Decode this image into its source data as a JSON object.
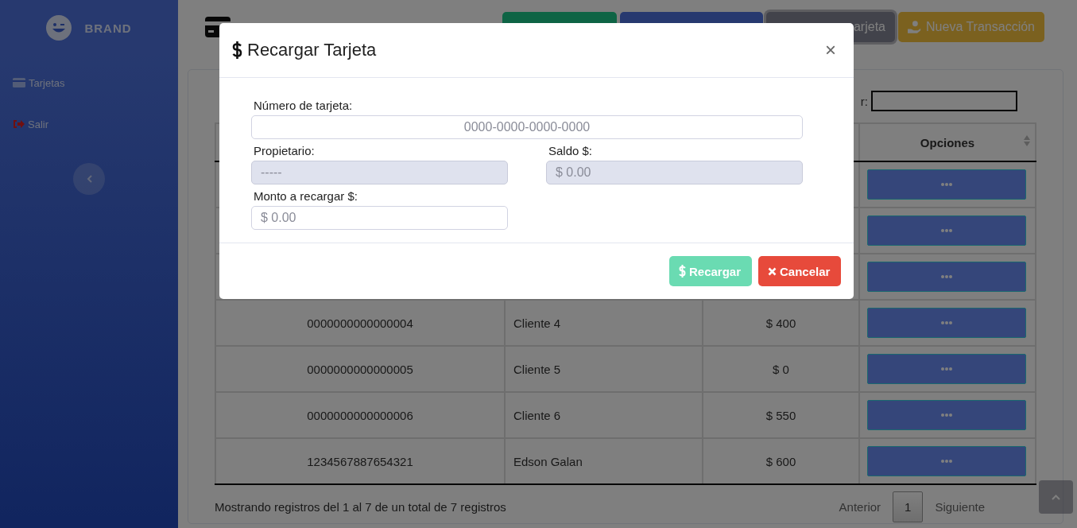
{
  "sidebar": {
    "brand": "BRAND",
    "items": [
      {
        "label": "Tarjetas",
        "kind": "cards"
      },
      {
        "label": "Salir",
        "kind": "logout"
      }
    ]
  },
  "header_buttons": [
    {
      "kind": "success",
      "focused": false
    },
    {
      "kind": "primary",
      "focused": false
    },
    {
      "label": "arjeta",
      "kind": "secondary",
      "focused": true
    },
    {
      "label": "Nueva Transacción",
      "kind": "warning",
      "focused": false
    }
  ],
  "table": {
    "search_label": "r:",
    "columns": [
      "Opciones"
    ],
    "rows": [
      {
        "kind": "covered"
      },
      {
        "kind": "covered"
      },
      {
        "kind": "covered"
      },
      {
        "kind": "visible",
        "card": "0000000000000004",
        "owner": "Cliente 4",
        "balance": "$ 400"
      },
      {
        "kind": "visible",
        "card": "0000000000000005",
        "owner": "Cliente 5",
        "balance": "$ 0"
      },
      {
        "kind": "visible",
        "card": "0000000000000006",
        "owner": "Cliente 6",
        "balance": "$ 550"
      },
      {
        "kind": "visible",
        "card": "1234567887654321",
        "owner": "Edson Galan",
        "balance": "$ 600"
      }
    ],
    "info": "Mostrando registros del 1 al 7 de un total de 7 registros",
    "pagination": [
      {
        "label": "Anterior",
        "selected": false
      },
      {
        "label": "1",
        "selected": true
      },
      {
        "label": "Siguiente",
        "selected": false
      }
    ]
  },
  "modal": {
    "title": "Recargar Tarjeta",
    "close": "×",
    "card_number": {
      "label": "Número de tarjeta:",
      "placeholder": "0000-0000-0000-0000"
    },
    "fields": [
      {
        "label": "Propietario:",
        "placeholder": "-----",
        "disabled": true
      },
      {
        "label": "Saldo $:",
        "placeholder": "$ 0.00",
        "disabled": true
      },
      {
        "label": "Monto a recargar $:",
        "placeholder": "$ 0.00",
        "disabled": false
      }
    ],
    "buttons": [
      {
        "label": "Recargar",
        "kind": "confirm",
        "disabled": true
      },
      {
        "label": "Cancelar",
        "kind": "cancel",
        "disabled": false
      }
    ]
  }
}
